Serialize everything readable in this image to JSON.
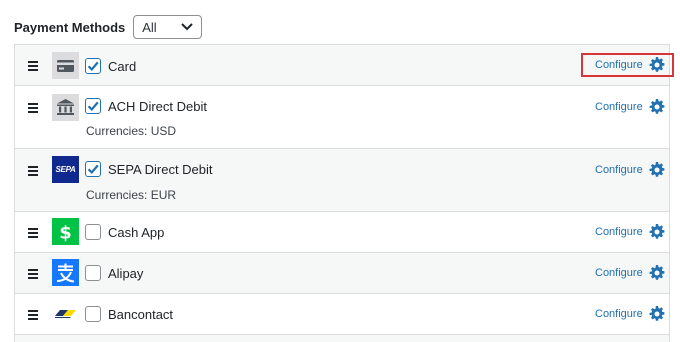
{
  "header": {
    "label": "Payment Methods",
    "filter_value": "All"
  },
  "methods": [
    {
      "name": "Card",
      "checked": true,
      "currencies": "",
      "configure": "Configure",
      "logo": "card-icon"
    },
    {
      "name": "ACH Direct Debit",
      "checked": true,
      "currencies": "Currencies: USD",
      "configure": "Configure",
      "logo": "bank-icon"
    },
    {
      "name": "SEPA Direct Debit",
      "checked": true,
      "currencies": "Currencies: EUR",
      "configure": "Configure",
      "logo": "sepa-logo",
      "logo_text": "SEPA"
    },
    {
      "name": "Cash App",
      "checked": false,
      "currencies": "",
      "configure": "Configure",
      "logo": "cash-app-logo"
    },
    {
      "name": "Alipay",
      "checked": false,
      "currencies": "",
      "configure": "Configure",
      "logo": "alipay-logo"
    },
    {
      "name": "Bancontact",
      "checked": false,
      "currencies": "",
      "configure": "Configure",
      "logo": "bancontact-logo"
    }
  ],
  "colors": {
    "accent": "#2271b1",
    "highlight": "#d63638",
    "cash_app": "#00c244",
    "alipay": "#1677ff",
    "sepa": "#10298e"
  }
}
